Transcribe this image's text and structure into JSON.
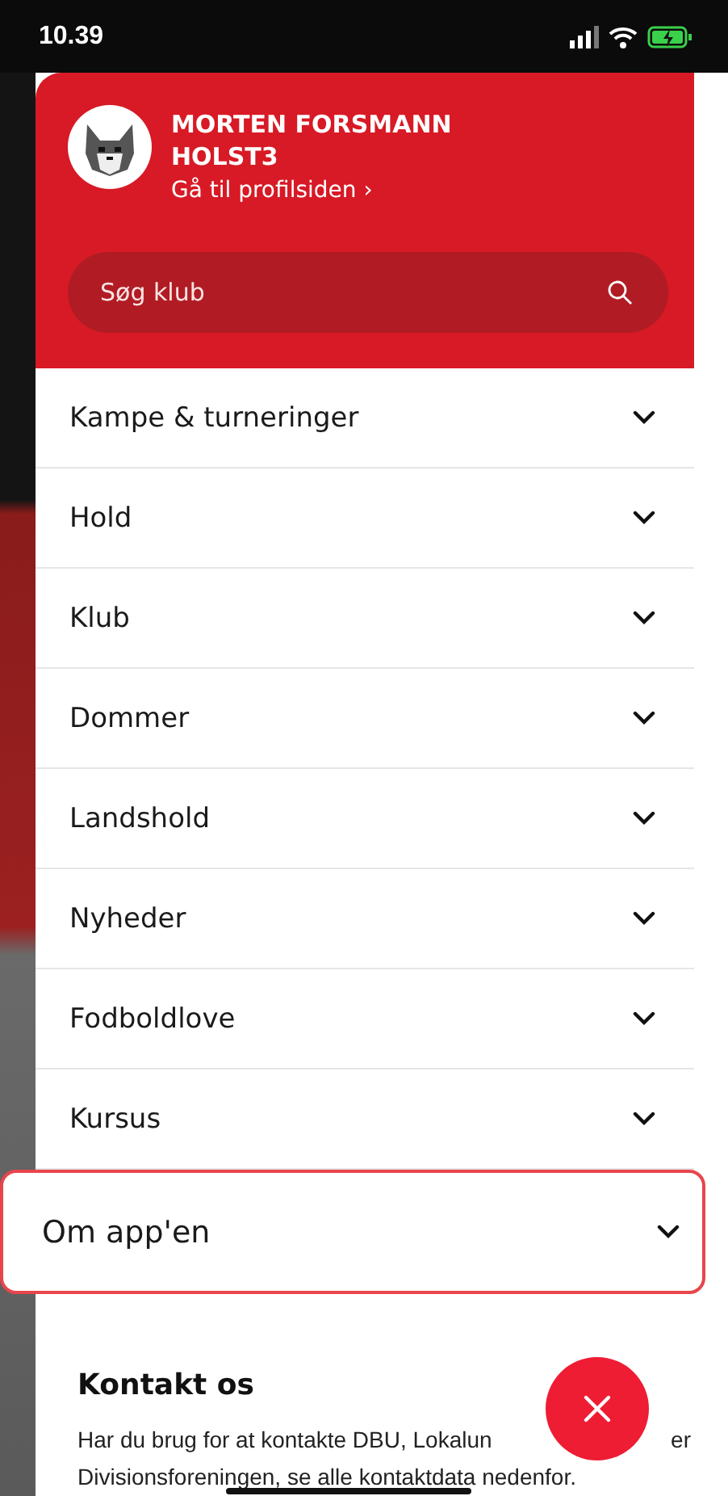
{
  "status_bar": {
    "time": "10.39"
  },
  "profile": {
    "name": "MORTEN FORSMANN HOLST3",
    "link": "Gå til profilsiden ›"
  },
  "search": {
    "placeholder": "Søg klub"
  },
  "menu": [
    {
      "label": "Kampe & turneringer",
      "highlighted": false
    },
    {
      "label": "Hold",
      "highlighted": false
    },
    {
      "label": "Klub",
      "highlighted": false
    },
    {
      "label": "Dommer",
      "highlighted": false
    },
    {
      "label": "Landshold",
      "highlighted": false
    },
    {
      "label": "Nyheder",
      "highlighted": false
    },
    {
      "label": "Fodboldlove",
      "highlighted": false
    },
    {
      "label": "Kursus",
      "highlighted": false
    },
    {
      "label": "Om app'en",
      "highlighted": true
    }
  ],
  "contact": {
    "title": "Kontakt os",
    "lines": [
      "Har du brug for at kontakte DBU, Lokalun",
      "er",
      "Divisionsforeningen, se alle kontaktdata nedenfor."
    ]
  }
}
